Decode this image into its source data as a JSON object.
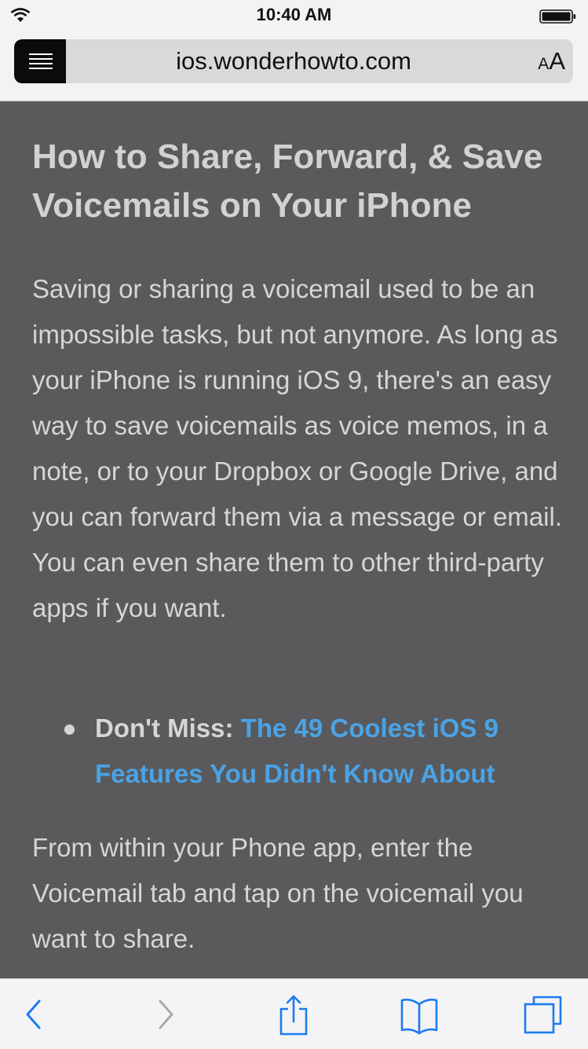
{
  "status_bar": {
    "time": "10:40 AM"
  },
  "address_bar": {
    "url": "ios.wonderhowto.com",
    "text_size_small": "A",
    "text_size_large": "A"
  },
  "article": {
    "title": "How to Share, Forward, & Save Voicemails on Your iPhone",
    "paragraph_1": "Saving or sharing a voicemail used to be an impossible tasks, but not anymore. As long as your iPhone is running iOS 9, there's an easy way to save voicemails as voice memos, in a note, or to your Dropbox or Google Drive, and you can forward them via a message or email. You can even share them to other third-party apps if you want.",
    "bullet_label": "Don't Miss: ",
    "bullet_link": "The 49 Coolest iOS 9 Features You Didn't Know About",
    "paragraph_2": "From within your Phone app, enter the Voicemail tab and tap on the voicemail you want to share."
  },
  "toolbar": {
    "icons": [
      "back-icon",
      "forward-icon",
      "share-icon",
      "bookmarks-icon",
      "tabs-icon"
    ]
  },
  "colors": {
    "background": "#5a5a5c",
    "text": "#d6d6d8",
    "link": "#4aa3e6",
    "toolbar_tint": "#1a7cf0",
    "toolbar_disabled": "#a9a9ad"
  }
}
